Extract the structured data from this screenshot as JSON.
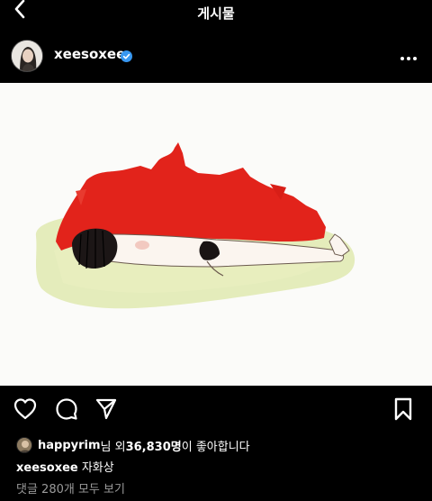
{
  "header": {
    "title": "게시물",
    "back_icon": "chevron-left-icon"
  },
  "post": {
    "username": "xeesoxee",
    "verified_icon": "verified-badge-icon",
    "more_icon": "more-horizontal-icon",
    "image_alt": "illustration"
  },
  "actions": {
    "like_icon": "heart-icon",
    "comment_icon": "comment-icon",
    "share_icon": "send-icon",
    "save_icon": "bookmark-icon"
  },
  "likes": {
    "first_liker": "happyrim",
    "middle_text": "님 외 ",
    "count": "36,830명",
    "suffix": "이 좋아합니다"
  },
  "caption": {
    "username": "xeesoxee",
    "text": " 자화상"
  },
  "comments": {
    "link_text": "댓글 280개 모두 보기"
  },
  "colors": {
    "background": "#000000",
    "verified": "#3897f0",
    "muted": "#9a9a9a"
  }
}
